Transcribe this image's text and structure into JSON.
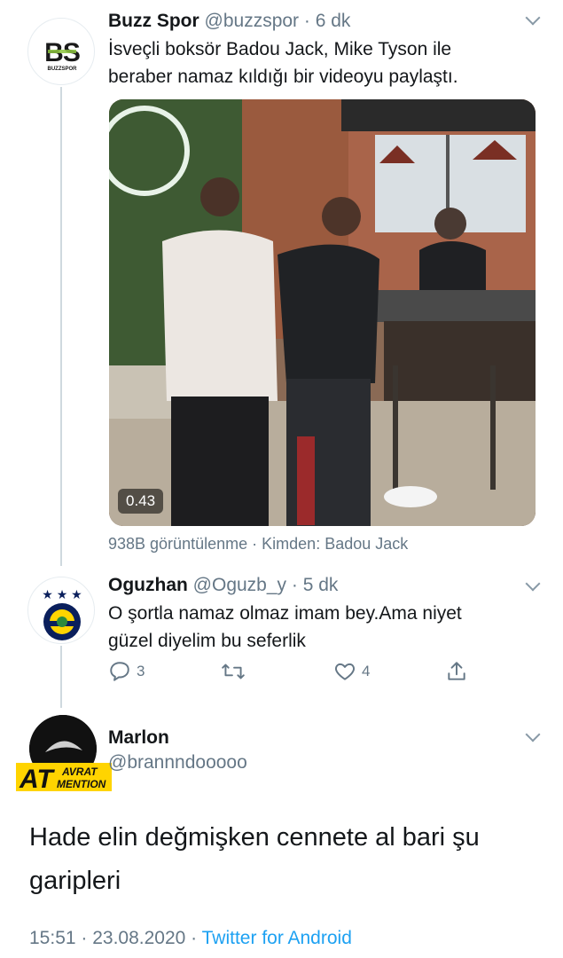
{
  "tweet1": {
    "avatar_text": "BS",
    "avatar_subtext": "BUZZSPOR",
    "name": "Buzz Spor",
    "handle": "@buzzspor",
    "separator": "·",
    "time": "6 dk",
    "text_line1": "İsveçli boksör Badou Jack, Mike Tyson ile",
    "text_line2": "beraber namaz kıldığı bir videoyu paylaştı.",
    "video_duration": "0.43",
    "views": "938B görüntülenme",
    "meta_separator": "·",
    "from_label": "Kimden: Badou Jack"
  },
  "tweet2": {
    "name": "Oguzhan",
    "handle": "@Oguzb_y",
    "separator": "·",
    "time": "5 dk",
    "text_line1": "O şortla namaz olmaz imam bey.Ama niyet",
    "text_line2": "güzel diyelim bu seferlik",
    "reply_count": "3",
    "retweet_count": "",
    "like_count": "4"
  },
  "tweet3": {
    "name": "Marlon",
    "handle": "@brannndooooo",
    "avatar_overlay_big": "AT",
    "avatar_overlay_small1": "AVRAT",
    "avatar_overlay_small2": "MENTION",
    "text_line1": "Hade elin değmişken cennete al bari şu",
    "text_line2": "garipleri",
    "timestamp": "15:51 · 23.08.2020",
    "footer_separator": "·",
    "source": "Twitter for Android"
  },
  "colors": {
    "accent": "#1da1f2",
    "secondary_text": "#657786",
    "thread_line": "#cfd9de"
  }
}
